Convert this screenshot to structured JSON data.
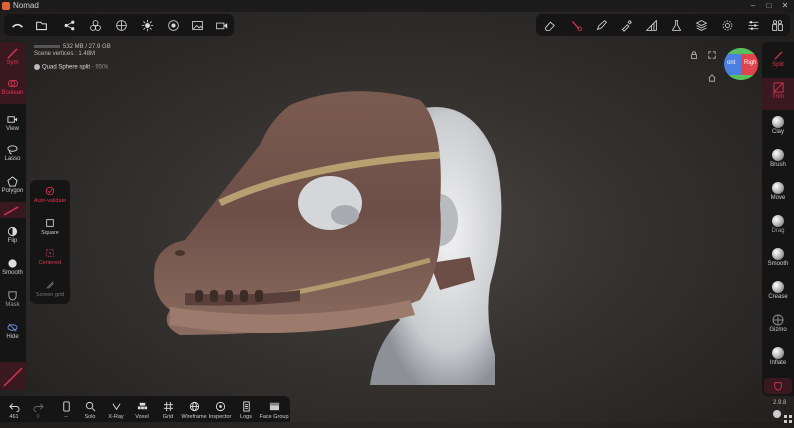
{
  "app": {
    "title": "Nomad",
    "version": "2.9.8"
  },
  "scene": {
    "memory": "532 MB / 27.9 GB",
    "vertices": "Scene vertices : 1.48M",
    "object_name": "Quad Sphere split",
    "object_vertices": "950k"
  },
  "gizmo": {
    "left_label": "ont",
    "right_label": "Righ"
  },
  "left_tools": [
    {
      "label": "Sym",
      "icon": "symmetry-icon"
    },
    {
      "label": "Boolean",
      "icon": "boolean-icon"
    },
    {
      "label": "View",
      "icon": "camera-icon"
    },
    {
      "label": "Lasso",
      "icon": "lasso-icon"
    },
    {
      "label": "Polygon",
      "icon": "polygon-icon"
    },
    {
      "label": "Flip",
      "icon": "flip-icon"
    },
    {
      "label": "Smooth",
      "icon": "smooth-icon"
    },
    {
      "label": "Mask",
      "icon": "mask-icon"
    },
    {
      "label": "Hide",
      "icon": "hide-icon"
    }
  ],
  "sub_tools": [
    {
      "label": "Auto-validate"
    },
    {
      "label": "Square"
    },
    {
      "label": "Centered"
    },
    {
      "label": "Screen grid"
    }
  ],
  "right_tools": [
    {
      "label": "Split"
    },
    {
      "label": "Trim"
    },
    {
      "label": "Clay"
    },
    {
      "label": "Brush"
    },
    {
      "label": "Move"
    },
    {
      "label": "Drag"
    },
    {
      "label": "Smooth"
    },
    {
      "label": "Crease"
    },
    {
      "label": "Gizmo"
    },
    {
      "label": "Inflate"
    }
  ],
  "bottom_tools": [
    {
      "label": "461",
      "icon": "undo-icon"
    },
    {
      "label": "0",
      "icon": "redo-icon"
    },
    {
      "label": "--",
      "icon": "phone-icon"
    },
    {
      "label": "Solo",
      "icon": "search-icon"
    },
    {
      "label": "X-Ray",
      "icon": "xray-icon"
    },
    {
      "label": "Voxel",
      "icon": "voxel-icon"
    },
    {
      "label": "Grid",
      "icon": "grid-icon"
    },
    {
      "label": "Wireframe",
      "icon": "wireframe-icon"
    },
    {
      "label": "Inspector",
      "icon": "inspector-icon"
    },
    {
      "label": "Logs",
      "icon": "logs-icon"
    },
    {
      "label": "Face Group",
      "icon": "facegroup-icon"
    }
  ],
  "colors": {
    "accent": "#d8344e",
    "panel": "#151515"
  }
}
